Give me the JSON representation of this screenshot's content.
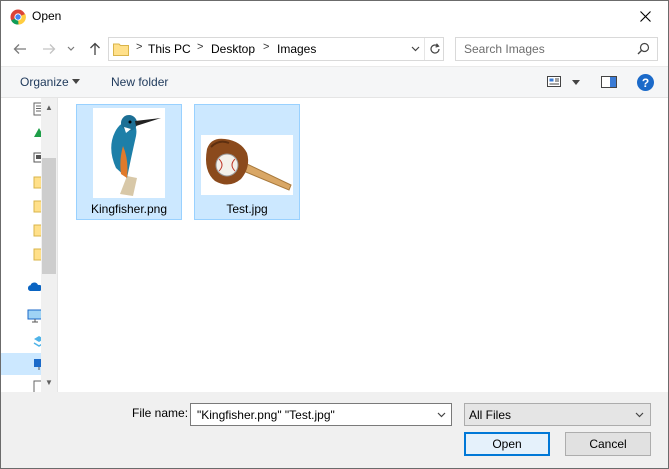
{
  "window": {
    "title": "Open",
    "app_icon": "chrome-icon",
    "close_icon": "close-icon"
  },
  "nav": {
    "back_icon": "back-arrow-icon",
    "forward_icon": "forward-arrow-icon",
    "recent_icon": "chevron-down-icon",
    "up_icon": "up-arrow-icon",
    "breadcrumbs": [
      "This PC",
      "Desktop",
      "Images"
    ],
    "separator": ">",
    "refresh_icon": "refresh-icon",
    "search_placeholder": "Search Images"
  },
  "commands": {
    "organize": "Organize",
    "new_folder": "New folder",
    "view_icon": "view-options-icon",
    "preview_pane_icon": "preview-pane-icon",
    "help": "?"
  },
  "nav_pane": {
    "icons": [
      "document-icon",
      "recycle-icon",
      "picture-icon",
      "folder-icon",
      "folder-icon",
      "folder-icon",
      "folder-icon",
      "onedrive-icon",
      "computer-icon",
      "dropbox-icon",
      "network-icon",
      "document-icon"
    ]
  },
  "files": [
    {
      "name": "Kingfisher.png",
      "thumbnail": "kingfisher-image",
      "selected": true
    },
    {
      "name": "Test.jpg",
      "thumbnail": "baseball-glove-image",
      "selected": true
    }
  ],
  "bottom": {
    "file_name_label": "File name:",
    "file_name_value": "\"Kingfisher.png\" \"Test.jpg\"",
    "filter_value": "All Files",
    "open_button": "Open",
    "cancel_button": "Cancel"
  },
  "colors": {
    "selection": "#cce8ff",
    "selection_border": "#99d1ff",
    "accent": "#0078d7",
    "help": "#1b6ac9"
  }
}
